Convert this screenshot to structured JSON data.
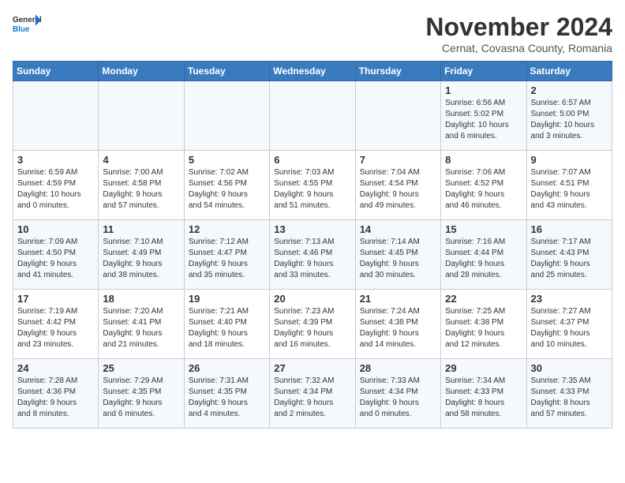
{
  "logo": {
    "line1": "General",
    "line2": "Blue"
  },
  "title": "November 2024",
  "location": "Cernat, Covasna County, Romania",
  "weekdays": [
    "Sunday",
    "Monday",
    "Tuesday",
    "Wednesday",
    "Thursday",
    "Friday",
    "Saturday"
  ],
  "weeks": [
    [
      {
        "day": "",
        "info": ""
      },
      {
        "day": "",
        "info": ""
      },
      {
        "day": "",
        "info": ""
      },
      {
        "day": "",
        "info": ""
      },
      {
        "day": "",
        "info": ""
      },
      {
        "day": "1",
        "info": "Sunrise: 6:56 AM\nSunset: 5:02 PM\nDaylight: 10 hours\nand 6 minutes."
      },
      {
        "day": "2",
        "info": "Sunrise: 6:57 AM\nSunset: 5:00 PM\nDaylight: 10 hours\nand 3 minutes."
      }
    ],
    [
      {
        "day": "3",
        "info": "Sunrise: 6:59 AM\nSunset: 4:59 PM\nDaylight: 10 hours\nand 0 minutes."
      },
      {
        "day": "4",
        "info": "Sunrise: 7:00 AM\nSunset: 4:58 PM\nDaylight: 9 hours\nand 57 minutes."
      },
      {
        "day": "5",
        "info": "Sunrise: 7:02 AM\nSunset: 4:56 PM\nDaylight: 9 hours\nand 54 minutes."
      },
      {
        "day": "6",
        "info": "Sunrise: 7:03 AM\nSunset: 4:55 PM\nDaylight: 9 hours\nand 51 minutes."
      },
      {
        "day": "7",
        "info": "Sunrise: 7:04 AM\nSunset: 4:54 PM\nDaylight: 9 hours\nand 49 minutes."
      },
      {
        "day": "8",
        "info": "Sunrise: 7:06 AM\nSunset: 4:52 PM\nDaylight: 9 hours\nand 46 minutes."
      },
      {
        "day": "9",
        "info": "Sunrise: 7:07 AM\nSunset: 4:51 PM\nDaylight: 9 hours\nand 43 minutes."
      }
    ],
    [
      {
        "day": "10",
        "info": "Sunrise: 7:09 AM\nSunset: 4:50 PM\nDaylight: 9 hours\nand 41 minutes."
      },
      {
        "day": "11",
        "info": "Sunrise: 7:10 AM\nSunset: 4:49 PM\nDaylight: 9 hours\nand 38 minutes."
      },
      {
        "day": "12",
        "info": "Sunrise: 7:12 AM\nSunset: 4:47 PM\nDaylight: 9 hours\nand 35 minutes."
      },
      {
        "day": "13",
        "info": "Sunrise: 7:13 AM\nSunset: 4:46 PM\nDaylight: 9 hours\nand 33 minutes."
      },
      {
        "day": "14",
        "info": "Sunrise: 7:14 AM\nSunset: 4:45 PM\nDaylight: 9 hours\nand 30 minutes."
      },
      {
        "day": "15",
        "info": "Sunrise: 7:16 AM\nSunset: 4:44 PM\nDaylight: 9 hours\nand 28 minutes."
      },
      {
        "day": "16",
        "info": "Sunrise: 7:17 AM\nSunset: 4:43 PM\nDaylight: 9 hours\nand 25 minutes."
      }
    ],
    [
      {
        "day": "17",
        "info": "Sunrise: 7:19 AM\nSunset: 4:42 PM\nDaylight: 9 hours\nand 23 minutes."
      },
      {
        "day": "18",
        "info": "Sunrise: 7:20 AM\nSunset: 4:41 PM\nDaylight: 9 hours\nand 21 minutes."
      },
      {
        "day": "19",
        "info": "Sunrise: 7:21 AM\nSunset: 4:40 PM\nDaylight: 9 hours\nand 18 minutes."
      },
      {
        "day": "20",
        "info": "Sunrise: 7:23 AM\nSunset: 4:39 PM\nDaylight: 9 hours\nand 16 minutes."
      },
      {
        "day": "21",
        "info": "Sunrise: 7:24 AM\nSunset: 4:38 PM\nDaylight: 9 hours\nand 14 minutes."
      },
      {
        "day": "22",
        "info": "Sunrise: 7:25 AM\nSunset: 4:38 PM\nDaylight: 9 hours\nand 12 minutes."
      },
      {
        "day": "23",
        "info": "Sunrise: 7:27 AM\nSunset: 4:37 PM\nDaylight: 9 hours\nand 10 minutes."
      }
    ],
    [
      {
        "day": "24",
        "info": "Sunrise: 7:28 AM\nSunset: 4:36 PM\nDaylight: 9 hours\nand 8 minutes."
      },
      {
        "day": "25",
        "info": "Sunrise: 7:29 AM\nSunset: 4:35 PM\nDaylight: 9 hours\nand 6 minutes."
      },
      {
        "day": "26",
        "info": "Sunrise: 7:31 AM\nSunset: 4:35 PM\nDaylight: 9 hours\nand 4 minutes."
      },
      {
        "day": "27",
        "info": "Sunrise: 7:32 AM\nSunset: 4:34 PM\nDaylight: 9 hours\nand 2 minutes."
      },
      {
        "day": "28",
        "info": "Sunrise: 7:33 AM\nSunset: 4:34 PM\nDaylight: 9 hours\nand 0 minutes."
      },
      {
        "day": "29",
        "info": "Sunrise: 7:34 AM\nSunset: 4:33 PM\nDaylight: 8 hours\nand 58 minutes."
      },
      {
        "day": "30",
        "info": "Sunrise: 7:35 AM\nSunset: 4:33 PM\nDaylight: 8 hours\nand 57 minutes."
      }
    ]
  ]
}
